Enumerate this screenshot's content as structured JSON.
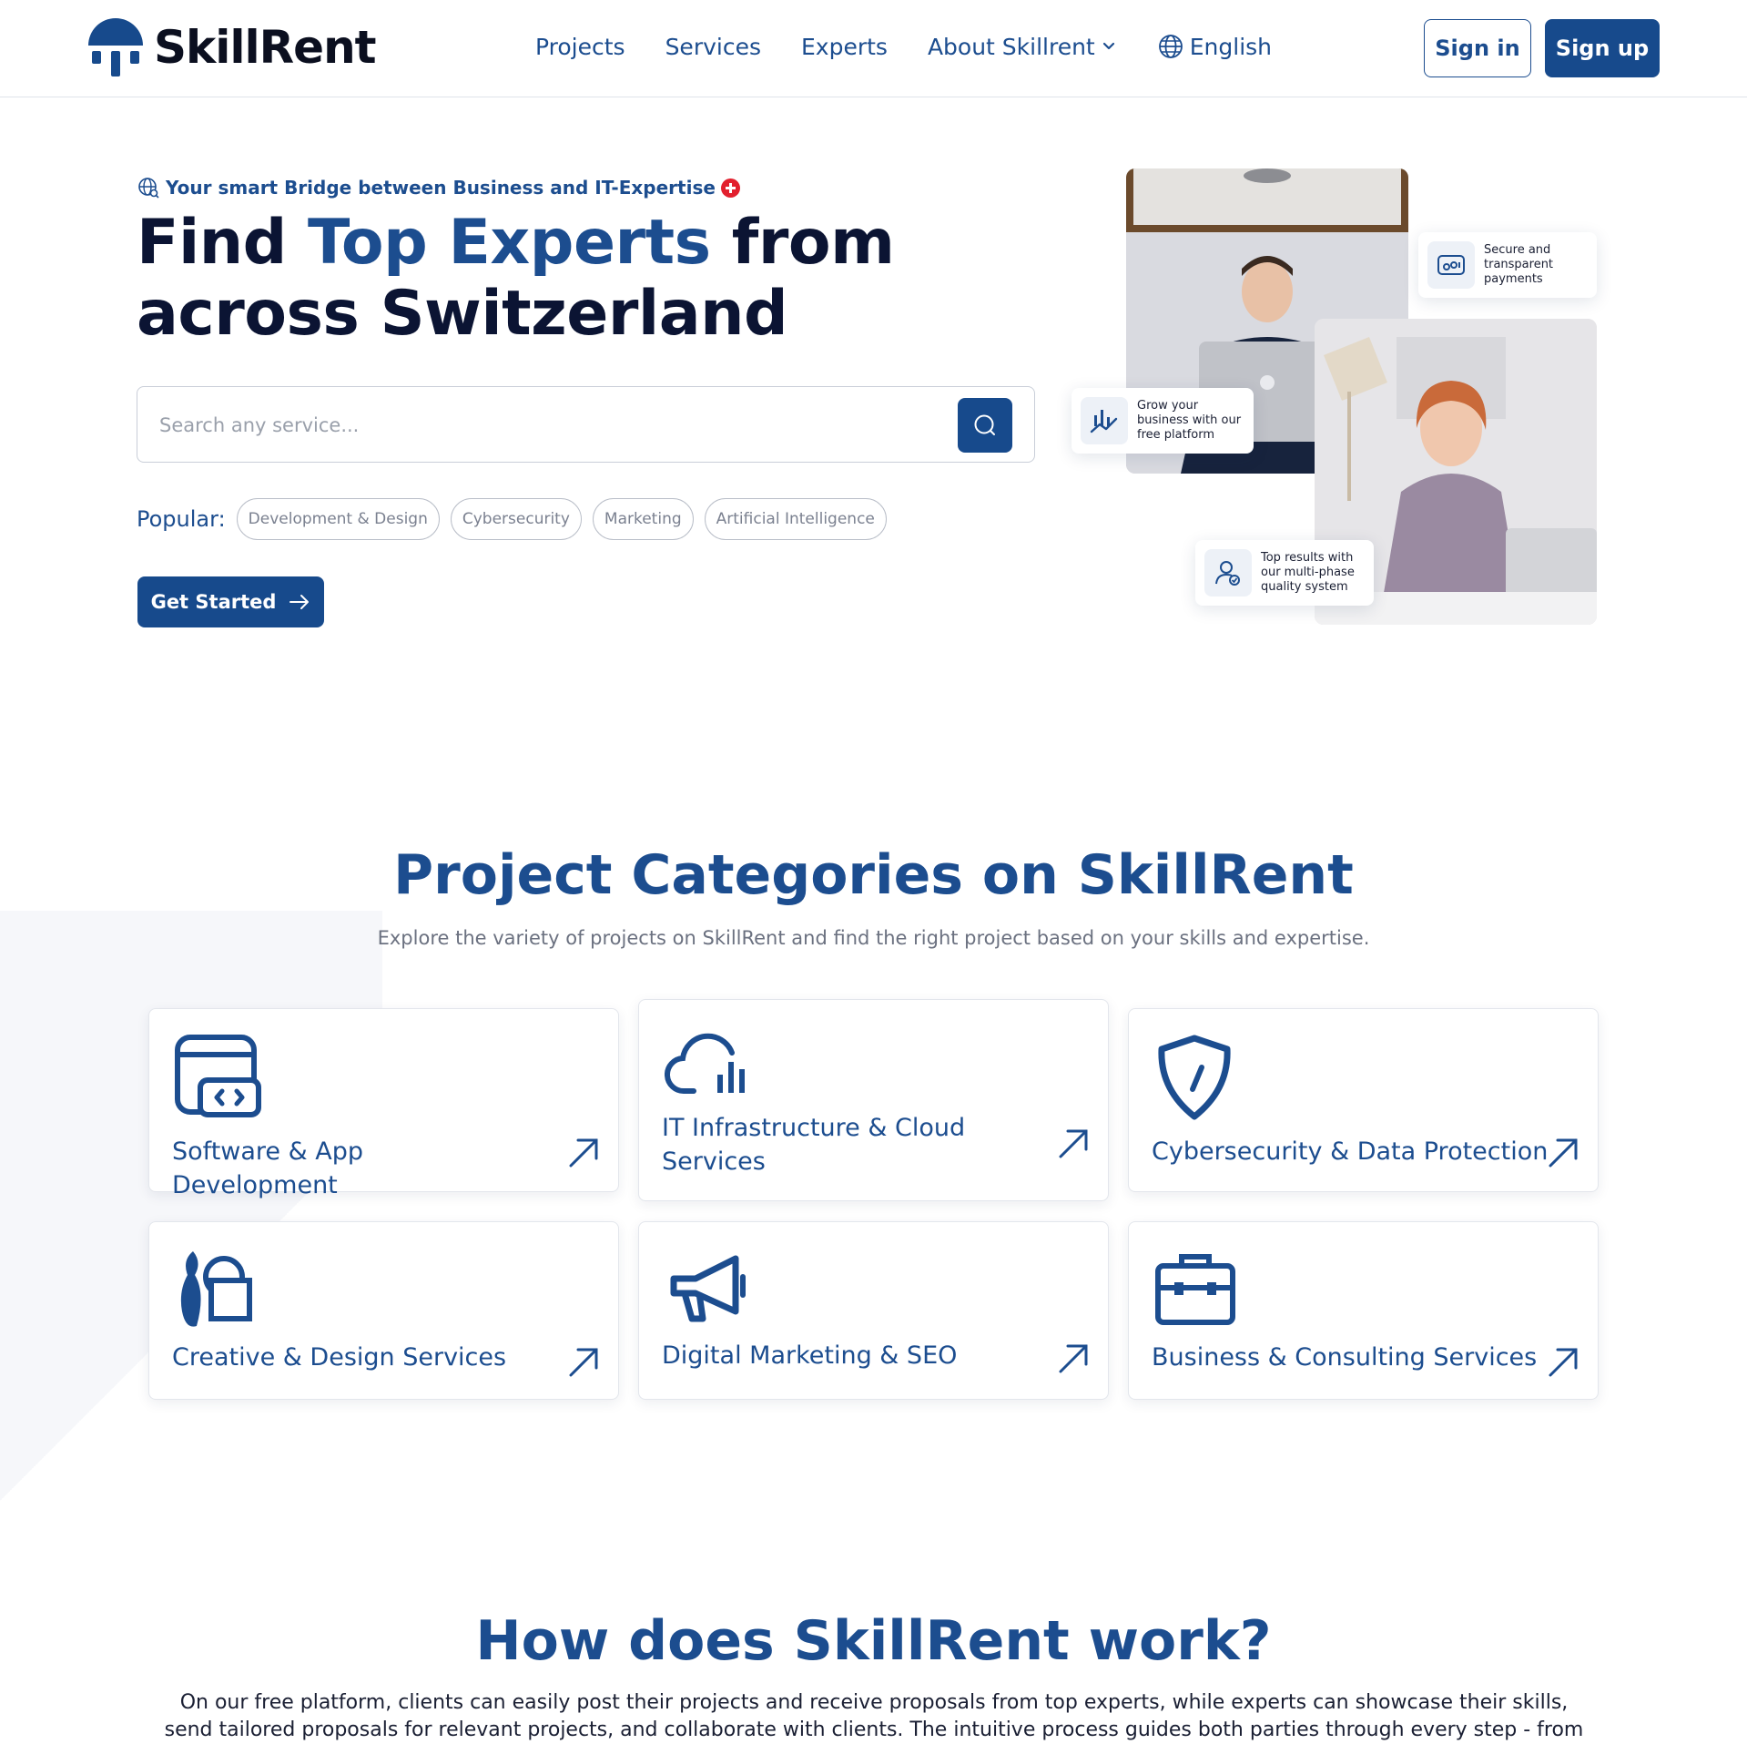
{
  "header": {
    "logo_text": "SkillRent",
    "nav": {
      "projects": "Projects",
      "services": "Services",
      "experts": "Experts",
      "about": "About Skillrent",
      "language": "English"
    },
    "sign_in": "Sign in",
    "sign_up": "Sign up"
  },
  "hero": {
    "tagline": "Your smart Bridge between Business and IT-Expertise",
    "title_part1": "Find ",
    "title_accent": "Top Experts",
    "title_part2": " from across Switzerland",
    "search_placeholder": "Search any service...",
    "popular_label": "Popular:",
    "popular_chips": [
      "Development & Design",
      "Cybersecurity",
      "Marketing",
      "Artificial Intelligence"
    ],
    "cta": "Get Started",
    "badges": {
      "payments": "Secure and transparent payments",
      "grow": "Grow your business with our free platform",
      "quality": "Top results with our multi-phase quality system"
    }
  },
  "categories": {
    "title": "Project Categories on SkillRent",
    "subtitle": "Explore the variety of projects on SkillRent and find the right project based on your skills and expertise.",
    "items": [
      {
        "label": "Software & App Development",
        "icon": "code-window-icon"
      },
      {
        "label": "IT Infrastructure & Cloud Services",
        "icon": "cloud-chart-icon"
      },
      {
        "label": "Cybersecurity & Data Protection",
        "icon": "shield-icon"
      },
      {
        "label": "Creative & Design Services",
        "icon": "brush-shapes-icon"
      },
      {
        "label": "Digital Marketing & SEO",
        "icon": "megaphone-icon"
      },
      {
        "label": "Business & Consulting Services",
        "icon": "briefcase-icon"
      }
    ]
  },
  "how_it_works": {
    "title": "How does SkillRent work?",
    "text": "On our free platform, clients can easily post their projects and receive proposals from top experts, while experts can showcase their skills, send tailored proposals for relevant projects, and collaborate with clients. The intuitive process guides both parties through every step - from posting"
  },
  "colors": {
    "brand": "#174a8c",
    "accent_text": "#1c4d8f",
    "dark_text": "#0b1433",
    "swiss_red": "#e2202e"
  }
}
